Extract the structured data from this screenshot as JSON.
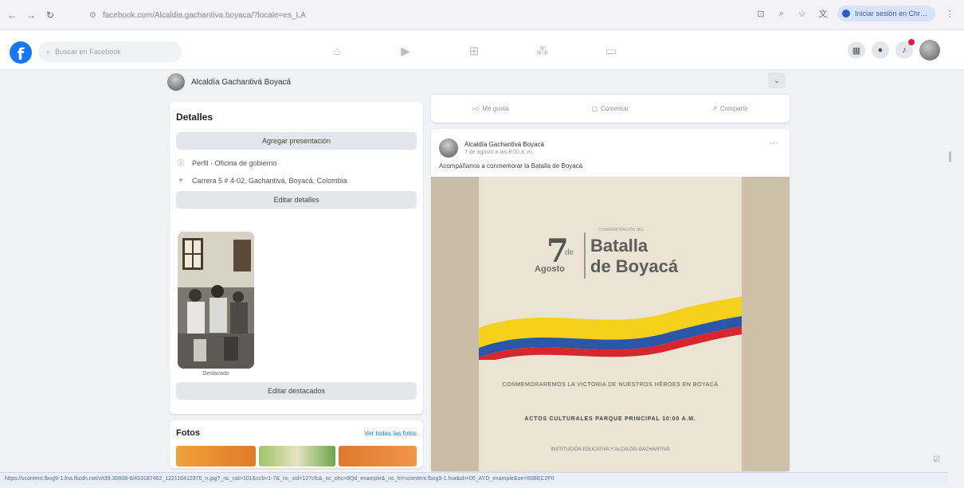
{
  "browser": {
    "url": "facebook.com/Alcaldia.gachantiva.boyaca/?locale=es_LA",
    "profile_button": "Iniciar sesión en Chr…",
    "status_url": "https://scontent.fbog9-1.fna.fbcdn.net/v/t39.30808-6/453187462_122116412376_n.jpg?_nc_cat=101&ccb=1-7&_nc_sid=127cfc&_nc_ohc=8Qd_example&_nc_ht=scontent.fbog9-1.fna&oh=00_AYD_example&oe=66BEC2F0"
  },
  "facebook": {
    "search_placeholder": "Buscar en Facebook",
    "profile_name": "Alcaldía Gachantivá Boyacá"
  },
  "details": {
    "title": "Detalles",
    "add_presentation": "Agregar presentación",
    "profile_type": "Perfil · Oficina de gobierno",
    "location": "Carrera 5 # 4-02, Gachantivá, Boyacá, Colombia",
    "edit_details": "Editar detalles",
    "featured_label": "Destacado",
    "edit_featured": "Editar destacados"
  },
  "photos": {
    "title": "Fotos",
    "see_all": "Ver todas las fotos"
  },
  "actions": {
    "like": "Me gusta",
    "comment": "Comentar",
    "share": "Compartir"
  },
  "post": {
    "author": "Alcaldía Gachantivá Boyacá",
    "date": "7 de agosto a las 8:00 a. m.",
    "text": "Acompáñanos a conmemorar la Batalla de Boyacá",
    "poster": {
      "kicker": "CONMEMORACIÓN DEL",
      "day": "7",
      "de": "de",
      "month": "Agosto",
      "title1": "Batalla",
      "title2": "de Boyacá",
      "line1": "CONMEMORAREMOS LA VICTORIA DE NUESTROS HÉROES EN BOYACÁ",
      "line2": "ACTOS CULTURALES PARQUE PRINCIPAL 10:00 A.M.",
      "line3": "INSTITUCIÓN EDUCATIVA Y ALCALDÍA GACHANTIVÁ"
    }
  },
  "colors": {
    "fb_blue": "#1877f2",
    "flag_yellow": "#f4d11a",
    "flag_blue": "#2c56a8",
    "flag_red": "#d8262f"
  }
}
